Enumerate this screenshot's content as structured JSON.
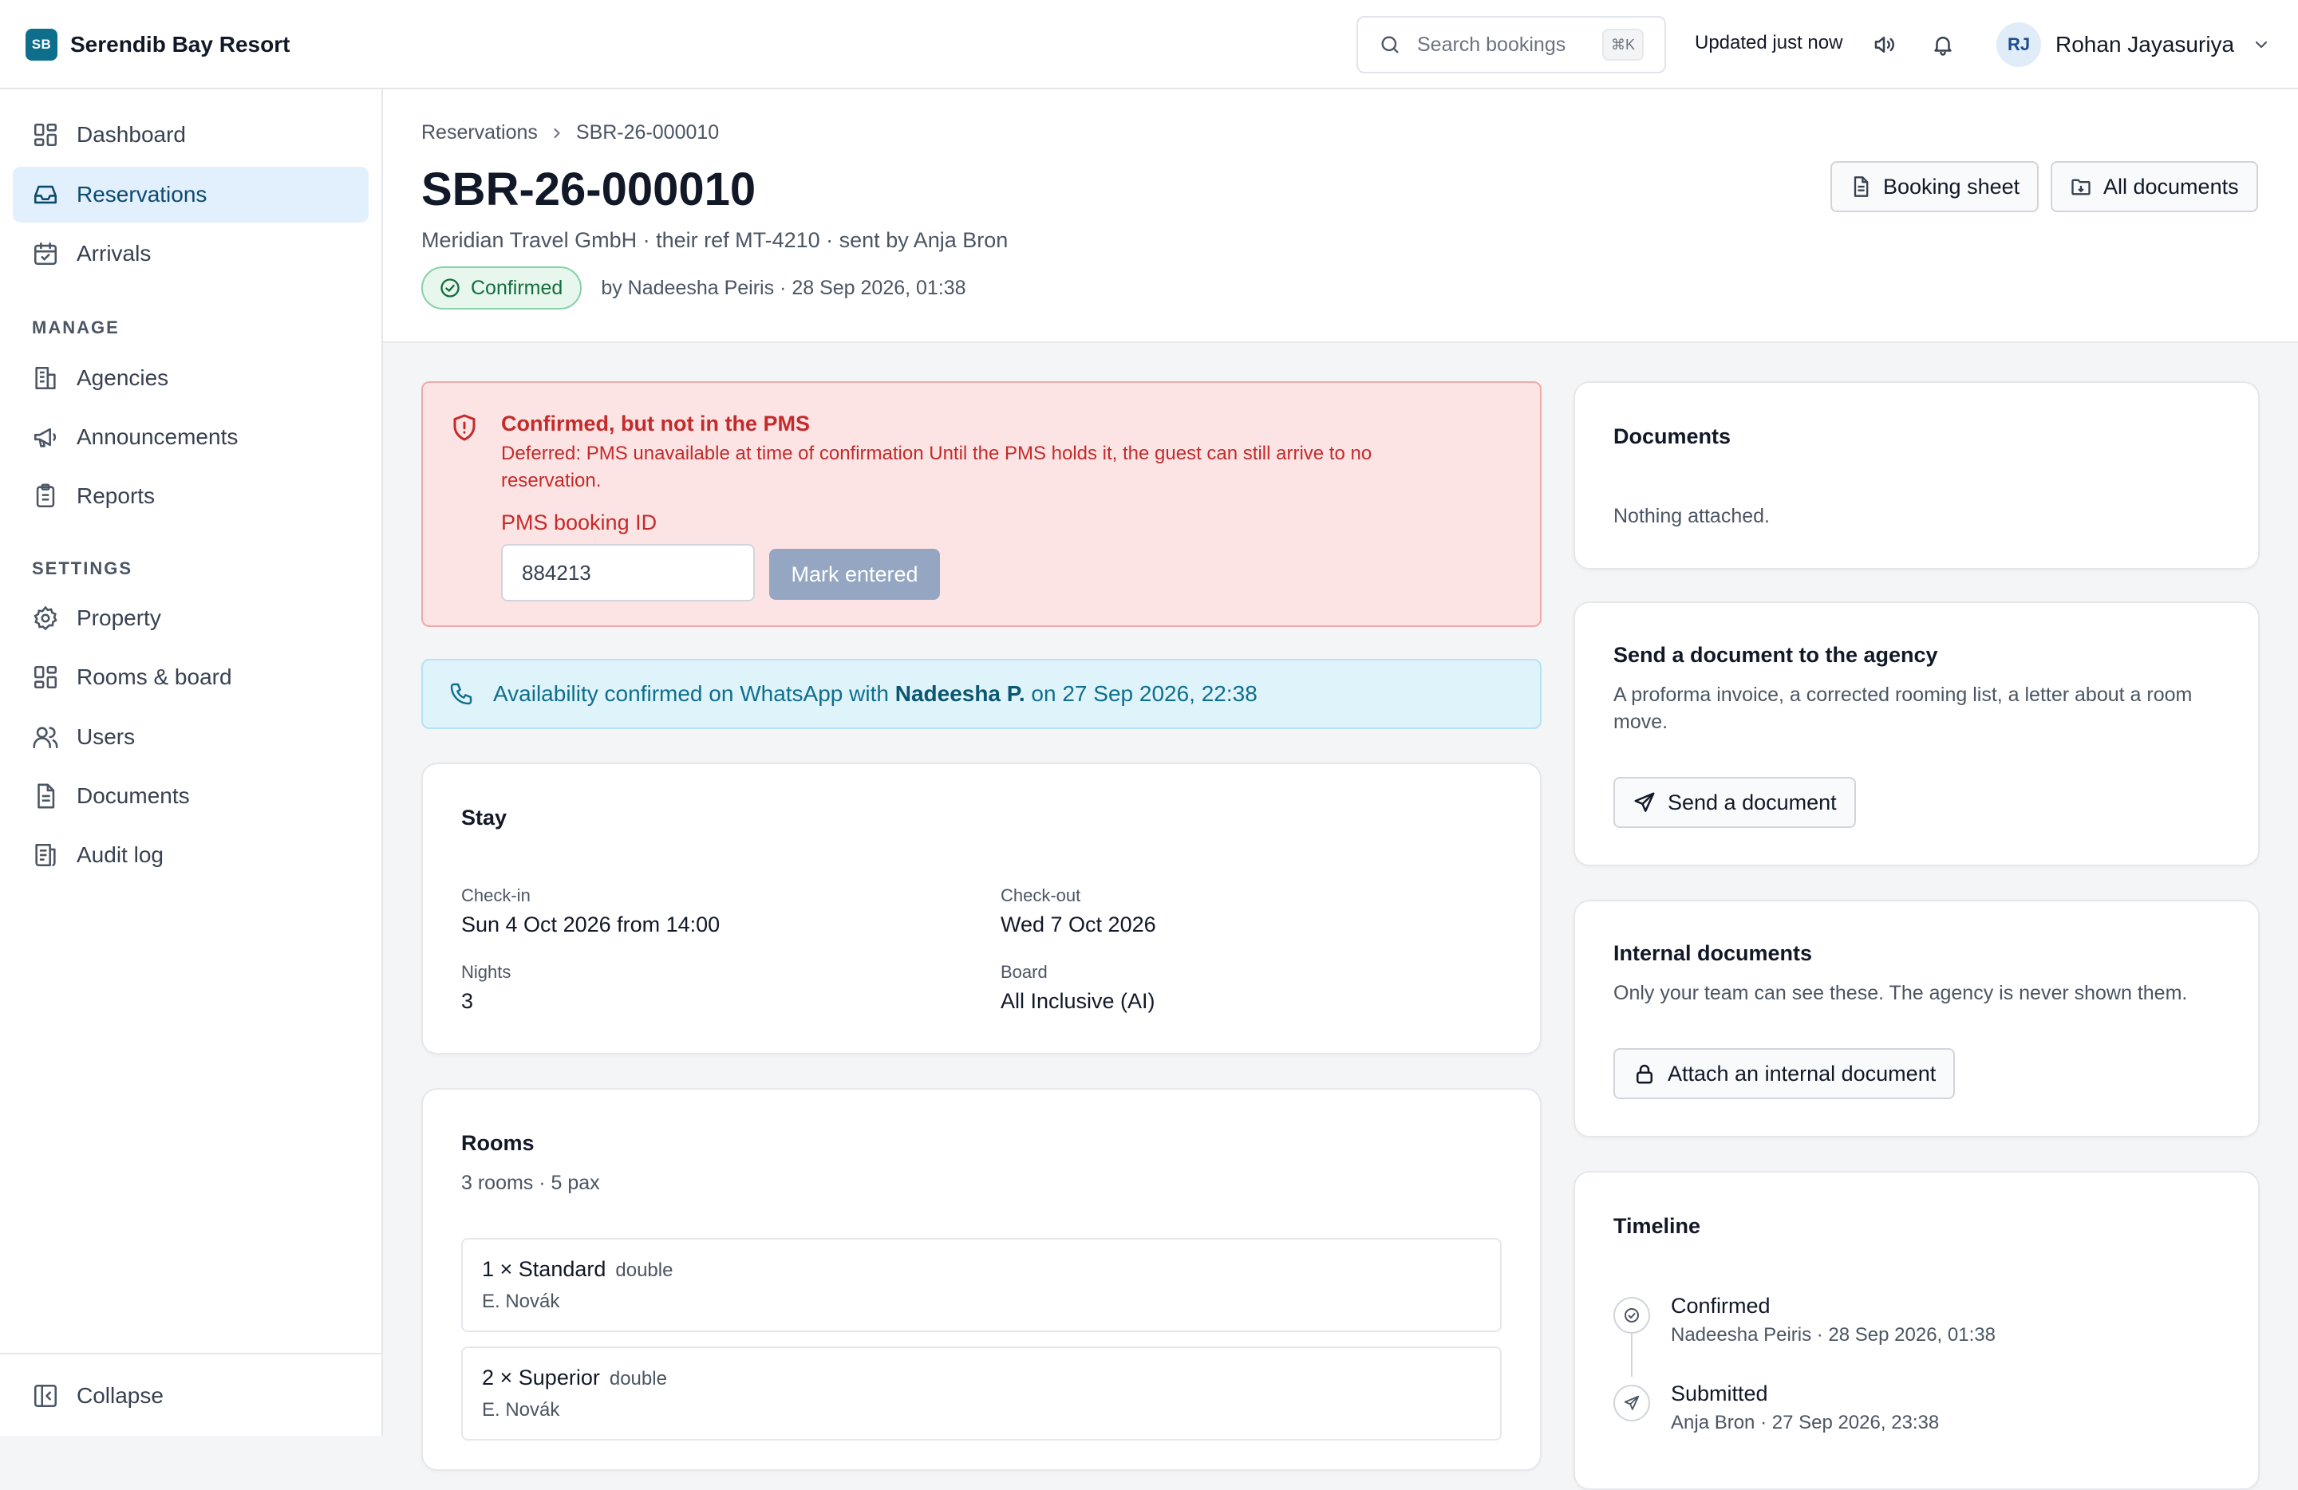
{
  "app": {
    "logo": "SB",
    "name": "Serendib Bay Resort"
  },
  "topbar": {
    "search_placeholder": "Search bookings",
    "search_shortcut": "⌘K",
    "updated": "Updated just now",
    "icons": [
      "speaker-icon",
      "bell-icon"
    ],
    "user": {
      "initials": "RJ",
      "name": "Rohan Jayasuriya"
    }
  },
  "sidebar": {
    "main": [
      {
        "label": "Dashboard",
        "icon": "dashboard-icon"
      },
      {
        "label": "Reservations",
        "icon": "inbox-icon",
        "active": true
      },
      {
        "label": "Arrivals",
        "icon": "calendar-icon"
      }
    ],
    "manage_heading": "MANAGE",
    "manage": [
      {
        "label": "Agencies",
        "icon": "building-icon"
      },
      {
        "label": "Announcements",
        "icon": "megaphone-icon"
      },
      {
        "label": "Reports",
        "icon": "clipboard-icon"
      }
    ],
    "settings_heading": "SETTINGS",
    "settings": [
      {
        "label": "Property",
        "icon": "gear-icon"
      },
      {
        "label": "Rooms & board",
        "icon": "grid-icon"
      },
      {
        "label": "Users",
        "icon": "users-icon"
      },
      {
        "label": "Documents",
        "icon": "document-icon"
      },
      {
        "label": "Audit log",
        "icon": "log-icon"
      }
    ],
    "collapse": "Collapse"
  },
  "header": {
    "breadcrumb": [
      "Reservations",
      "SBR-26-000010"
    ],
    "title": "SBR-26-000010",
    "subtitle": "Meridian Travel GmbH · their ref MT-4210 · sent by Anja Bron",
    "status": "Confirmed",
    "status_meta": "by Nadeesha Peiris · 28 Sep 2026, 01:38",
    "buttons": {
      "booking_sheet": "Booking sheet",
      "all_documents": "All documents"
    }
  },
  "alert": {
    "title": "Confirmed, but not in the PMS",
    "body": "Deferred: PMS unavailable at time of confirmation Until the PMS holds it, the guest can still arrive to no reservation.",
    "field_label": "PMS booking ID",
    "field_value": "884213",
    "button": "Mark entered"
  },
  "info": {
    "prefix": "Availability confirmed on WhatsApp with ",
    "name": "Nadeesha P.",
    "suffix": " on 27 Sep 2026, 22:38"
  },
  "stay": {
    "title": "Stay",
    "checkin_label": "Check-in",
    "checkin": "Sun 4 Oct 2026 from 14:00",
    "checkout_label": "Check-out",
    "checkout": "Wed 7 Oct 2026",
    "nights_label": "Nights",
    "nights": "3",
    "board_label": "Board",
    "board": "All Inclusive (AI)"
  },
  "rooms": {
    "title": "Rooms",
    "summary": "3 rooms · 5 pax",
    "items": [
      {
        "name": "1 × Standard",
        "type": "double",
        "guest": "E. Novák"
      },
      {
        "name": "2 × Superior",
        "type": "double",
        "guest": "E. Novák"
      }
    ]
  },
  "documents": {
    "title": "Documents",
    "empty": "Nothing attached."
  },
  "send_doc": {
    "title": "Send a document to the agency",
    "desc": "A proforma invoice, a corrected rooming list, a letter about a room move.",
    "button": "Send a document"
  },
  "internal_docs": {
    "title": "Internal documents",
    "desc": "Only your team can see these. The agency is never shown them.",
    "button": "Attach an internal document"
  },
  "timeline": {
    "title": "Timeline",
    "events": [
      {
        "title": "Confirmed",
        "meta": "Nadeesha Peiris · 28 Sep 2026, 01:38"
      },
      {
        "title": "Submitted",
        "meta": "Anja Bron · 27 Sep 2026, 23:38"
      }
    ]
  },
  "colors": {
    "accent": "#0e6f8c",
    "nav_active_bg": "#e2effc",
    "success": "#146c3d",
    "danger": "#c52a2a",
    "info_bg": "#dff3fb"
  }
}
